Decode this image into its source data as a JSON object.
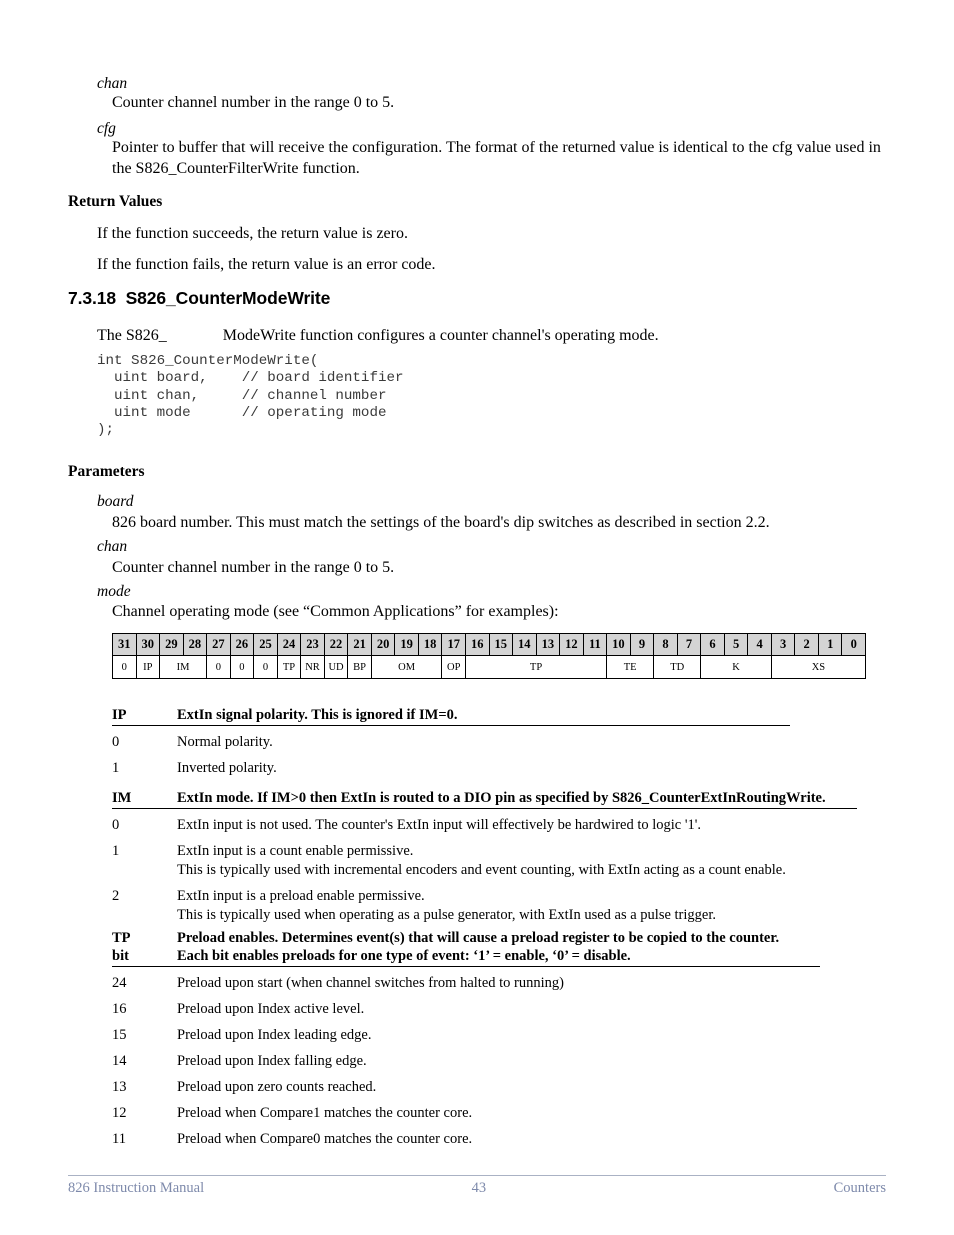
{
  "doc": {
    "params_top": {
      "chan_term": "chan",
      "chan_def": "Counter channel number in the range 0 to 5.",
      "cfg_term": "cfg",
      "cfg_def": "Pointer to buffer that will receive the configuration. The format of the returned value is identical to the cfg value used in the S826_CounterFilterWrite function."
    },
    "return_values": {
      "label": "Return Values",
      "success": "If the function succeeds, the return value is zero.",
      "failure": "If the function fails, the return value is an error code."
    },
    "section": {
      "heading": "7.3.18  S826_CounterModeWrite",
      "intro": "The S826_              ModeWrite function configures a counter channel's operating mode.",
      "code": "int S826_CounterModeWrite(\n  uint board,    // board identifier\n  uint chan,     // channel number\n  uint mode      // operating mode\n);"
    },
    "parameters": {
      "label": "Parameters",
      "board_term": "board",
      "board_def": "826 board number. This must match the settings of the board's dip switches as described in section 2.2.",
      "chan_term": "chan",
      "chan_def": "Counter channel number in the range 0 to 5.",
      "mode_term": "mode",
      "mode_def": "Channel operating mode (see “Common Applications” for examples):"
    },
    "bit_table": {
      "bits": [
        "31",
        "30",
        "29",
        "28",
        "27",
        "26",
        "25",
        "24",
        "23",
        "22",
        "21",
        "20",
        "19",
        "18",
        "17",
        "16",
        "15",
        "14",
        "13",
        "12",
        "11",
        "10",
        "9",
        "8",
        "7",
        "6",
        "5",
        "4",
        "3",
        "2",
        "1",
        "0"
      ],
      "fields": [
        {
          "label": "0",
          "span": 1
        },
        {
          "label": "IP",
          "span": 1
        },
        {
          "label": "IM",
          "span": 2
        },
        {
          "label": "0",
          "span": 1
        },
        {
          "label": "0",
          "span": 1
        },
        {
          "label": "0",
          "span": 1
        },
        {
          "label": "TP",
          "span": 1
        },
        {
          "label": "NR",
          "span": 1
        },
        {
          "label": "UD",
          "span": 1
        },
        {
          "label": "BP",
          "span": 1
        },
        {
          "label": "OM",
          "span": 3
        },
        {
          "label": "OP",
          "span": 1
        },
        {
          "label": "TP",
          "span": 6
        },
        {
          "label": "TE",
          "span": 2
        },
        {
          "label": "TD",
          "span": 2
        },
        {
          "label": "K",
          "span": 3
        },
        {
          "label": "XS",
          "span": 4
        }
      ]
    },
    "field_ip": {
      "key": "IP",
      "title": "ExtIn signal polarity. This is ignored if IM=0.",
      "rows": [
        {
          "key": "0",
          "desc": "Normal polarity.",
          "sub": ""
        },
        {
          "key": "1",
          "desc": "Inverted polarity.",
          "sub": ""
        }
      ]
    },
    "field_im": {
      "key": "IM",
      "title": "ExtIn mode. If IM>0 then ExtIn is routed to a DIO pin as specified by S826_CounterExtInRoutingWrite.",
      "rows": [
        {
          "key": "0",
          "desc": "ExtIn input is not used. The counter's ExtIn input will effectively be hardwired to logic '1'.",
          "sub": ""
        },
        {
          "key": "1",
          "desc": "ExtIn input is a count enable permissive.",
          "sub": "This is typically used with incremental encoders and event counting, with ExtIn acting as a count enable."
        },
        {
          "key": "2",
          "desc": "ExtIn input is a preload enable permissive.",
          "sub": "This is typically used when operating as a pulse generator, with ExtIn used as a pulse trigger."
        }
      ]
    },
    "field_tp": {
      "key_line1": "TP",
      "key_line2": "bit",
      "title_line1": "Preload enables. Determines event(s) that will cause a preload register to be copied to the counter.",
      "title_line2": "Each bit enables preloads for one type of event: ‘1’ = enable, ‘0’ = disable.",
      "rows": [
        {
          "key": "24",
          "desc": "Preload upon start (when channel switches from halted to running)"
        },
        {
          "key": "16",
          "desc": "Preload upon Index active level."
        },
        {
          "key": "15",
          "desc": "Preload upon Index leading edge."
        },
        {
          "key": "14",
          "desc": "Preload upon Index falling edge."
        },
        {
          "key": "13",
          "desc": "Preload upon zero counts reached."
        },
        {
          "key": "12",
          "desc": "Preload when Compare1 matches the counter core."
        },
        {
          "key": "11",
          "desc": "Preload when Compare0 matches the counter core."
        }
      ]
    },
    "footer": {
      "left": "826 Instruction Manual",
      "page": "43",
      "right": "Counters"
    }
  }
}
